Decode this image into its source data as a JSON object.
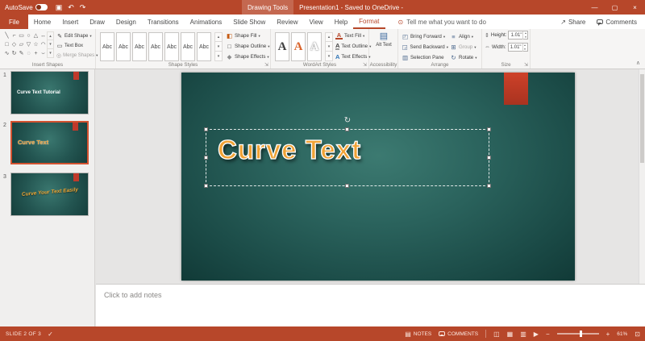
{
  "titlebar": {
    "autosave_label": "AutoSave",
    "context_label": "Drawing Tools",
    "doc_title": "Presentation1 - Saved to OneDrive -"
  },
  "tabs": {
    "items": [
      "File",
      "Home",
      "Insert",
      "Draw",
      "Design",
      "Transitions",
      "Animations",
      "Slide Show",
      "Review",
      "View",
      "Help",
      "Format"
    ],
    "active_tab": "Format",
    "tell_me": "Tell me what you want to do",
    "share_label": "Share",
    "comments_label": "Comments"
  },
  "ribbon": {
    "insert_shapes": {
      "label": "Insert Shapes",
      "glyphs": [
        "╲",
        "⌐",
        "▭",
        "○",
        "△",
        "↔",
        "□",
        "◇",
        "▱",
        "▽",
        "☆",
        "◠",
        "∿",
        "↻",
        "✎",
        "◌",
        "+",
        "⌣"
      ],
      "edit_shape": "Edit Shape",
      "text_box": "Text Box",
      "merge_shapes": "Merge Shapes"
    },
    "shape_styles": {
      "label": "Shape Styles",
      "preset": "Abc",
      "shape_fill": "Shape Fill",
      "shape_outline": "Shape Outline",
      "shape_effects": "Shape Effects"
    },
    "wordart_styles": {
      "label": "WordArt Styles",
      "letter": "A",
      "text_fill": "Text Fill",
      "text_outline": "Text Outline",
      "text_effects": "Text Effects"
    },
    "accessibility": {
      "label": "Accessibility",
      "alt_text": "Alt Text"
    },
    "arrange": {
      "label": "Arrange",
      "bring_forward": "Bring Forward",
      "send_backward": "Send Backward",
      "selection_pane": "Selection Pane",
      "align": "Align",
      "group": "Group",
      "rotate": "Rotate"
    },
    "size": {
      "label": "Size",
      "height_label": "Height:",
      "height_value": "1.01\"",
      "width_label": "Width:",
      "width_value": "1.01\""
    }
  },
  "slides_panel": {
    "slides": [
      {
        "number": "1",
        "title": "Curve Text Tutorial"
      },
      {
        "number": "2",
        "title": "Curve Text"
      },
      {
        "number": "3",
        "title": "Curve Your Text Easily"
      }
    ]
  },
  "canvas": {
    "wordart_text": "Curve Text"
  },
  "notes": {
    "placeholder": "Click to add notes"
  },
  "statusbar": {
    "slide_indicator": "SLIDE 2 OF 3",
    "notes_label": "NOTES",
    "comments_label": "COMMENTS",
    "zoom_percent": "61%"
  },
  "colors": {
    "accent": "#b7472a",
    "slide_teal_center": "#3c7a71",
    "slide_teal_edge": "#113a37",
    "wordart_orange": "#f0a235",
    "shape_red": "#c0392b"
  },
  "icons": {
    "save": "▣",
    "undo": "↶",
    "redo": "↷",
    "minimize": "—",
    "maximize": "▢",
    "close": "×",
    "lightbulb": "⊙",
    "share": "↗",
    "caret": "▾",
    "up": "▴",
    "edit_shape": "✎",
    "text_box": "▭",
    "merge_shapes": "◎",
    "shape_fill": "◧",
    "shape_outline": "□",
    "shape_effects": "◆",
    "letter_a": "A",
    "alt_text": "▤",
    "bring_forward": "◰",
    "send_backward": "◲",
    "selection_pane": "▥",
    "align": "≡",
    "group": "⊞",
    "rotate": "↻",
    "height": "⇕",
    "width": "⇔",
    "dialog_launcher": "⇲",
    "ribbon_collapse": "∧",
    "rotate_handle": "↻",
    "proofing": "✓",
    "notes_view": "▤",
    "normal_view": "◫",
    "sorter_view": "▦",
    "reading_view": "▥",
    "slideshow_view": "▶",
    "zoom_out": "−",
    "zoom_in": "+",
    "fit_window": "⊡"
  }
}
